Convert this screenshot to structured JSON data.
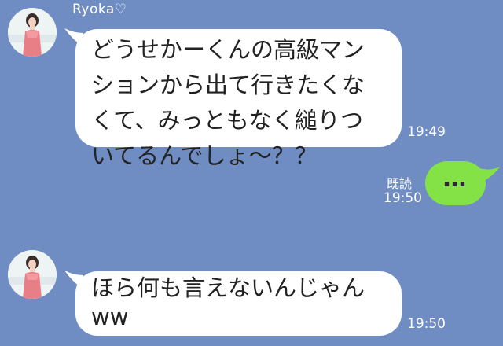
{
  "chat": {
    "contact": {
      "name": "Ryoka♡",
      "avatar_icon": "profile-photo-woman-pink-dress"
    },
    "messages": [
      {
        "direction": "incoming",
        "lines": [
          "どうせかーくんの高級マン",
          "ションから出て行きたくな",
          "くて、みっともなく縋りつ",
          "いてるんでしょ～？？"
        ],
        "time": "19:49"
      },
      {
        "direction": "outgoing",
        "text": "…",
        "status": "既読",
        "time": "19:50"
      },
      {
        "direction": "incoming",
        "lines": [
          "ほら何も言えないんじゃん",
          "ww"
        ],
        "time": "19:50"
      }
    ]
  },
  "colors": {
    "background": "#6f8dc3",
    "incoming_bubble": "#ffffff",
    "outgoing_bubble": "#84e246"
  }
}
